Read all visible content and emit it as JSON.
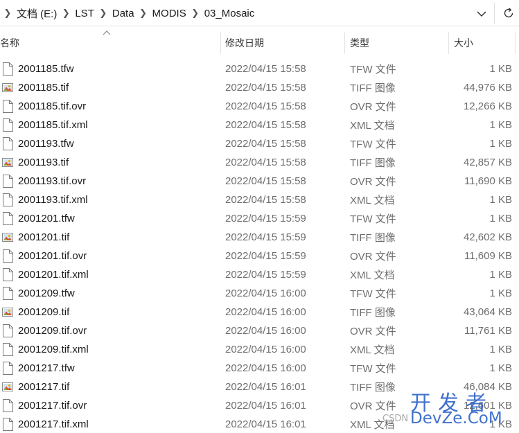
{
  "breadcrumb": {
    "items": [
      "文档 (E:)",
      "LST",
      "Data",
      "MODIS",
      "03_Mosaic"
    ]
  },
  "columns": {
    "name": "名称",
    "date": "修改日期",
    "type": "类型",
    "size": "大小",
    "sorted_by": "name",
    "sort_direction": "ascending"
  },
  "files": [
    {
      "name": "2001185.tfw",
      "date": "2022/04/15 15:58",
      "type": "TFW 文件",
      "size": "1 KB",
      "icon": "generic-file-icon"
    },
    {
      "name": "2001185.tif",
      "date": "2022/04/15 15:58",
      "type": "TIFF 图像",
      "size": "44,976 KB",
      "icon": "image-file-icon"
    },
    {
      "name": "2001185.tif.ovr",
      "date": "2022/04/15 15:58",
      "type": "OVR 文件",
      "size": "12,266 KB",
      "icon": "generic-file-icon"
    },
    {
      "name": "2001185.tif.xml",
      "date": "2022/04/15 15:58",
      "type": "XML 文档",
      "size": "1 KB",
      "icon": "generic-file-icon"
    },
    {
      "name": "2001193.tfw",
      "date": "2022/04/15 15:58",
      "type": "TFW 文件",
      "size": "1 KB",
      "icon": "generic-file-icon"
    },
    {
      "name": "2001193.tif",
      "date": "2022/04/15 15:58",
      "type": "TIFF 图像",
      "size": "42,857 KB",
      "icon": "image-file-icon"
    },
    {
      "name": "2001193.tif.ovr",
      "date": "2022/04/15 15:58",
      "type": "OVR 文件",
      "size": "11,690 KB",
      "icon": "generic-file-icon"
    },
    {
      "name": "2001193.tif.xml",
      "date": "2022/04/15 15:58",
      "type": "XML 文档",
      "size": "1 KB",
      "icon": "generic-file-icon"
    },
    {
      "name": "2001201.tfw",
      "date": "2022/04/15 15:59",
      "type": "TFW 文件",
      "size": "1 KB",
      "icon": "generic-file-icon"
    },
    {
      "name": "2001201.tif",
      "date": "2022/04/15 15:59",
      "type": "TIFF 图像",
      "size": "42,602 KB",
      "icon": "image-file-icon"
    },
    {
      "name": "2001201.tif.ovr",
      "date": "2022/04/15 15:59",
      "type": "OVR 文件",
      "size": "11,609 KB",
      "icon": "generic-file-icon"
    },
    {
      "name": "2001201.tif.xml",
      "date": "2022/04/15 15:59",
      "type": "XML 文档",
      "size": "1 KB",
      "icon": "generic-file-icon"
    },
    {
      "name": "2001209.tfw",
      "date": "2022/04/15 16:00",
      "type": "TFW 文件",
      "size": "1 KB",
      "icon": "generic-file-icon"
    },
    {
      "name": "2001209.tif",
      "date": "2022/04/15 16:00",
      "type": "TIFF 图像",
      "size": "43,064 KB",
      "icon": "image-file-icon"
    },
    {
      "name": "2001209.tif.ovr",
      "date": "2022/04/15 16:00",
      "type": "OVR 文件",
      "size": "11,761 KB",
      "icon": "generic-file-icon"
    },
    {
      "name": "2001209.tif.xml",
      "date": "2022/04/15 16:00",
      "type": "XML 文档",
      "size": "1 KB",
      "icon": "generic-file-icon"
    },
    {
      "name": "2001217.tfw",
      "date": "2022/04/15 16:00",
      "type": "TFW 文件",
      "size": "1 KB",
      "icon": "generic-file-icon"
    },
    {
      "name": "2001217.tif",
      "date": "2022/04/15 16:01",
      "type": "TIFF 图像",
      "size": "46,084 KB",
      "icon": "image-file-icon"
    },
    {
      "name": "2001217.tif.ovr",
      "date": "2022/04/15 16:01",
      "type": "OVR 文件",
      "size": "12,601 KB",
      "icon": "generic-file-icon"
    },
    {
      "name": "2001217.tif.xml",
      "date": "2022/04/15 16:01",
      "type": "XML 文档",
      "size": "1 KB",
      "icon": "generic-file-icon"
    }
  ],
  "watermark": {
    "cn": "开发者",
    "en": "DevZe.CoM",
    "csdn": "CSDN"
  },
  "icons": {
    "address_dropdown": "chevron-down-icon",
    "refresh": "refresh-icon",
    "breadcrumb_separator": "chevron-right-icon",
    "sort": "sort-up-icon"
  },
  "colors": {
    "watermark": "#2c62c9",
    "secondary_text": "#6d6d6d",
    "divider": "#e3e3e3"
  }
}
